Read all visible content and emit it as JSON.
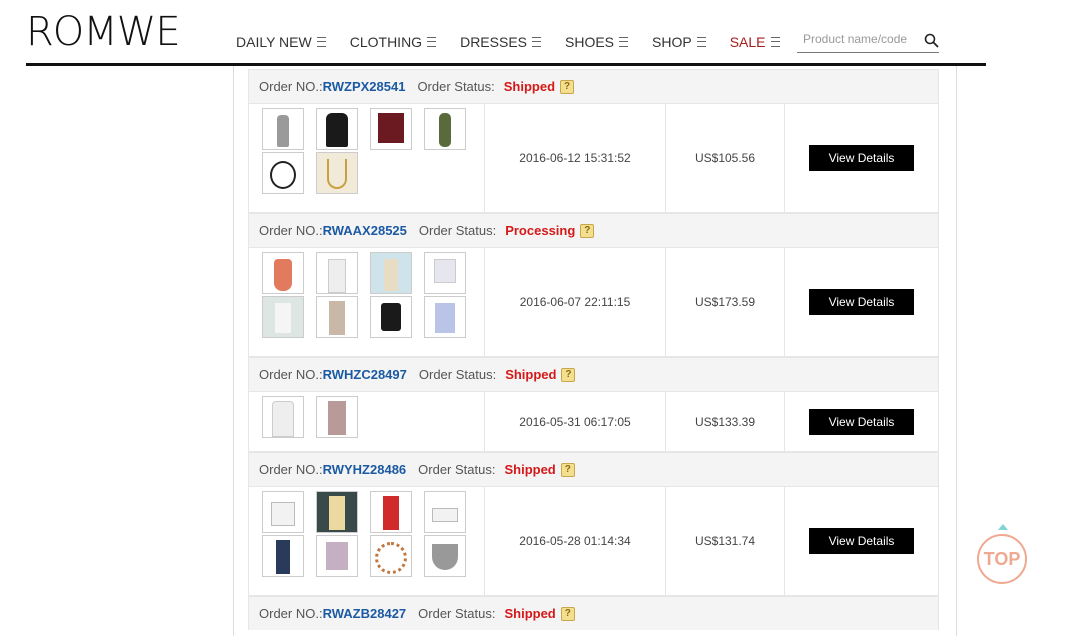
{
  "brand": {
    "logo": "ROMWE"
  },
  "nav": [
    {
      "label": "DAILY NEW"
    },
    {
      "label": "CLOTHING"
    },
    {
      "label": "DRESSES"
    },
    {
      "label": "SHOES"
    },
    {
      "label": "SHOP"
    },
    {
      "label": "SALE"
    }
  ],
  "search": {
    "placeholder": "Product name/code"
  },
  "labels": {
    "order_no": "Order NO.:",
    "order_status": "Order Status:",
    "view_details": "View Details",
    "help_mark": "?"
  },
  "orders": [
    {
      "number": "RWZPX28541",
      "status": "Shipped",
      "date": "2016-06-12 15:31:52",
      "total": "US$105.56",
      "items": [
        "grey jumpsuit",
        "black jumpsuit",
        "burgundy cami",
        "olive dress",
        "choker necklace",
        "gold necklace"
      ]
    },
    {
      "number": "RWAAX28525",
      "status": "Processing",
      "date": "2016-06-07 22:11:15",
      "total": "US$173.59",
      "items": [
        "coral dress",
        "white dress",
        "floral dress",
        "white top",
        "white romper",
        "print dress",
        "black dress",
        "blue dress"
      ]
    },
    {
      "number": "RWHZC28497",
      "status": "Shipped",
      "date": "2016-05-31 06:17:05",
      "total": "US$133.39",
      "items": [
        "white maxi dress",
        "print maxi dress"
      ]
    },
    {
      "number": "RWYHZ28486",
      "status": "Shipped",
      "date": "2016-05-28 01:14:34",
      "total": "US$131.74",
      "items": [
        "white heels",
        "yellow dress",
        "red dress",
        "white sandals",
        "navy jumpsuit",
        "pink top",
        "floral necklace",
        "statement necklace"
      ]
    },
    {
      "number": "RWAZB28427",
      "status": "Shipped"
    }
  ],
  "scroll_top": {
    "label": "TOP"
  },
  "colors": {
    "status_red": "#d51818",
    "order_blue": "#1b5aa3",
    "sale_red": "#a51e1e",
    "top_button": "#f0a890"
  }
}
